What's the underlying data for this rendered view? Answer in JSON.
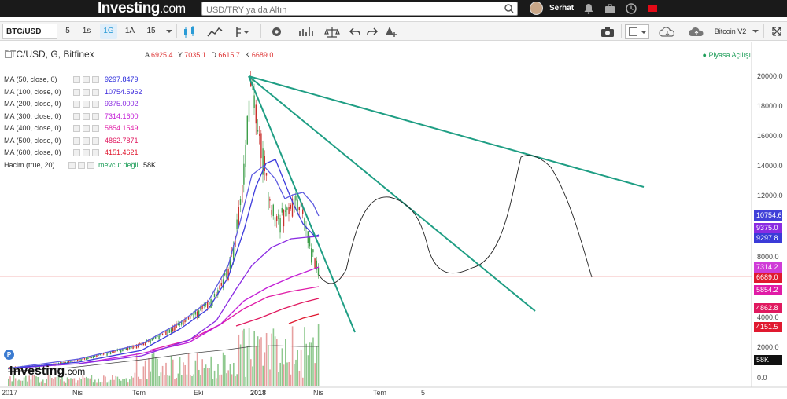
{
  "header": {
    "logo_main": "Investing",
    "logo_suffix": ".com",
    "search_placeholder": "USD/TRY ya da Altın",
    "username": "Serhat"
  },
  "toolbar": {
    "symbol": "BTC/USD",
    "intervals": [
      "5",
      "1s",
      "1G",
      "1A",
      "15"
    ],
    "selected_interval": "1G",
    "indicator_preset": "Bitcoin V2"
  },
  "chart": {
    "title": "BTC/USD, G, Bitfinex",
    "ohlc": {
      "a_label": "A",
      "a": "6925.4",
      "y_label": "Y",
      "y": "7035.1",
      "d_label": "D",
      "d": "6615.7",
      "k_label": "K",
      "k": "6689.0"
    },
    "market_status": "Piyasa Açılışı",
    "indicators": [
      {
        "label": "MA (50, close, 0)",
        "value": "9297.8479",
        "color": "#2b2bdc"
      },
      {
        "label": "MA (100, close, 0)",
        "value": "10754.5962",
        "color": "#3d2bdc"
      },
      {
        "label": "MA (200, close, 0)",
        "value": "9375.0002",
        "color": "#8a2be2"
      },
      {
        "label": "MA (300, close, 0)",
        "value": "7314.1600",
        "color": "#c21bd6"
      },
      {
        "label": "MA (400, close, 0)",
        "value": "5854.1549",
        "color": "#e01ba6"
      },
      {
        "label": "MA (500, close, 0)",
        "value": "4862.7871",
        "color": "#e0195f"
      },
      {
        "label": "MA (600, close, 0)",
        "value": "4151.4621",
        "color": "#e0192f"
      }
    ],
    "volume": {
      "label": "Hacim (true, 20)",
      "status": "mevcut değil",
      "value": "58K"
    },
    "y_axis_labels": [
      "20000.0",
      "18000.0",
      "16000.0",
      "14000.0",
      "12000.0",
      "8000.0",
      "4000.0",
      "2000.0",
      "0.0"
    ],
    "price_tags": [
      {
        "text": "10754.6",
        "color": "#4040d8"
      },
      {
        "text": "9375.0",
        "color": "#8a2be2"
      },
      {
        "text": "9297.8",
        "color": "#3b3bd8"
      },
      {
        "text": "7314.2",
        "color": "#d03cd8"
      },
      {
        "text": "6689.0",
        "color": "#e0192f"
      },
      {
        "text": "5854.2",
        "color": "#e01ba6"
      },
      {
        "text": "4862.8",
        "color": "#e0195f"
      },
      {
        "text": "4151.5",
        "color": "#e0192f"
      },
      {
        "text": "58K",
        "color": "#111111"
      }
    ],
    "x_axis_labels": [
      "2017",
      "Nis",
      "Tem",
      "Eki",
      "2018",
      "Nis",
      "Tem",
      "5"
    ],
    "watermark": "Investing",
    "watermark_suffix": ".com",
    "p_button": "P"
  }
}
